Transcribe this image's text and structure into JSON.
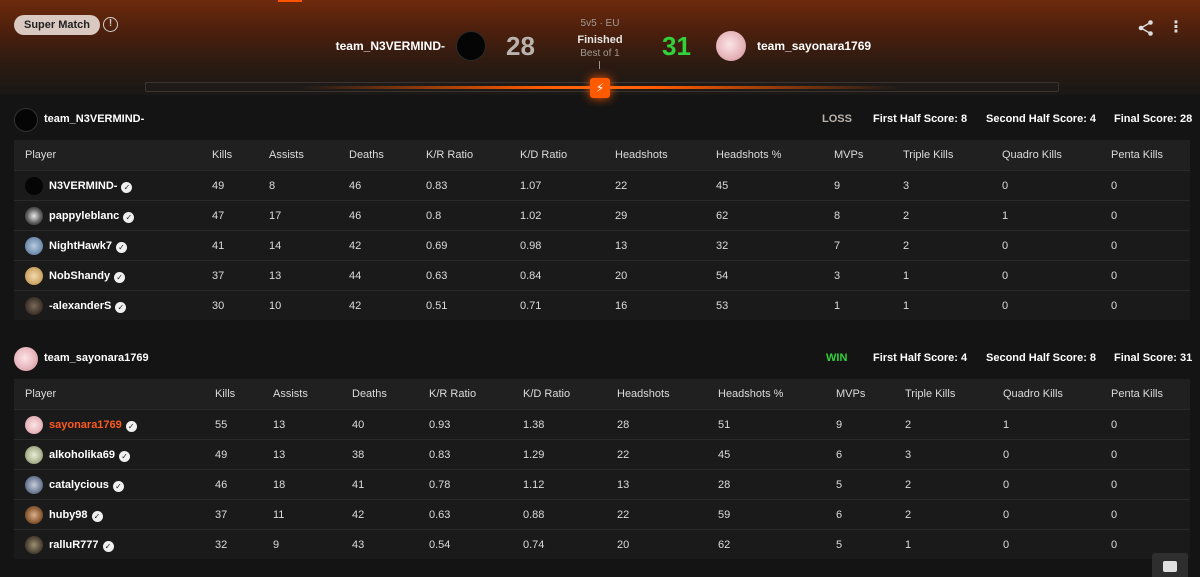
{
  "header": {
    "badge": "Super Match",
    "mode": "5v5 · EU",
    "status": "Finished",
    "best_of": "Best of 1",
    "left_team": {
      "name": "team_N3VERMIND-",
      "score": "28"
    },
    "right_team": {
      "name": "team_sayonara1769",
      "score": "31"
    }
  },
  "colors": {
    "accent": "#ff5a00",
    "win": "#32d23b",
    "loss": "#b9b3ae"
  },
  "columns": [
    "Player",
    "Kills",
    "Assists",
    "Deaths",
    "K/R Ratio",
    "K/D Ratio",
    "Headshots",
    "Headshots %",
    "MVPs",
    "Triple Kills",
    "Quadro Kills",
    "Penta Kills"
  ],
  "teams": [
    {
      "name": "team_N3VERMIND-",
      "result": "LOSS",
      "first_half": "First Half Score: 8",
      "second_half": "Second Half Score: 4",
      "final": "Final Score: 28",
      "players": [
        {
          "name": "N3VERMIND-",
          "stats": [
            "49",
            "8",
            "46",
            "0.83",
            "1.07",
            "22",
            "45",
            "9",
            "3",
            "0",
            "0"
          ]
        },
        {
          "name": "pappyleblanc",
          "stats": [
            "47",
            "17",
            "46",
            "0.8",
            "1.02",
            "29",
            "62",
            "8",
            "2",
            "1",
            "0"
          ]
        },
        {
          "name": "NightHawk7",
          "stats": [
            "41",
            "14",
            "42",
            "0.69",
            "0.98",
            "13",
            "32",
            "7",
            "2",
            "0",
            "0"
          ]
        },
        {
          "name": "NobShandy",
          "stats": [
            "37",
            "13",
            "44",
            "0.63",
            "0.84",
            "20",
            "54",
            "3",
            "1",
            "0",
            "0"
          ]
        },
        {
          "name": "-alexanderS",
          "stats": [
            "30",
            "10",
            "42",
            "0.51",
            "0.71",
            "16",
            "53",
            "1",
            "1",
            "0",
            "0"
          ]
        }
      ]
    },
    {
      "name": "team_sayonara1769",
      "result": "WIN",
      "first_half": "First Half Score: 4",
      "second_half": "Second Half Score: 8",
      "final": "Final Score: 31",
      "players": [
        {
          "name": "sayonara1769",
          "stats": [
            "55",
            "13",
            "40",
            "0.93",
            "1.38",
            "28",
            "51",
            "9",
            "2",
            "1",
            "0"
          ]
        },
        {
          "name": "alkoholika69",
          "stats": [
            "49",
            "13",
            "38",
            "0.83",
            "1.29",
            "22",
            "45",
            "6",
            "3",
            "0",
            "0"
          ]
        },
        {
          "name": "catalycious",
          "stats": [
            "46",
            "18",
            "41",
            "0.78",
            "1.12",
            "13",
            "28",
            "5",
            "2",
            "0",
            "0"
          ]
        },
        {
          "name": "huby98",
          "stats": [
            "37",
            "11",
            "42",
            "0.63",
            "0.88",
            "22",
            "59",
            "6",
            "2",
            "0",
            "0"
          ]
        },
        {
          "name": "ralluR777",
          "stats": [
            "32",
            "9",
            "43",
            "0.54",
            "0.74",
            "20",
            "62",
            "5",
            "1",
            "0",
            "0"
          ]
        }
      ]
    }
  ]
}
